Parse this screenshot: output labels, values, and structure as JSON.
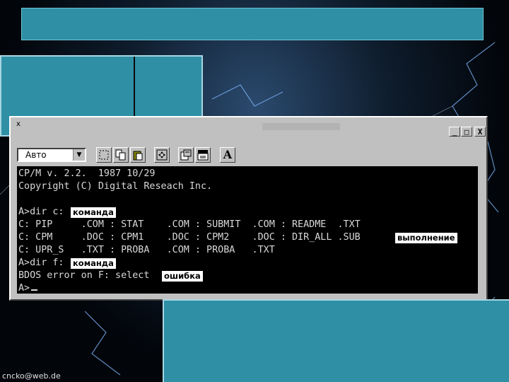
{
  "footer": {
    "email": "cncko@web.de"
  },
  "window": {
    "caption_glyph": "x",
    "buttons": {
      "minimize": "_",
      "maximize": "□",
      "close": "X"
    }
  },
  "toolbar": {
    "font_select": "Авто",
    "dropdown_arrow": "▼",
    "text_button": "A",
    "icons": [
      "select-icon",
      "copy-icon",
      "paste-icon",
      "fullscreen-icon",
      "properties-icon",
      "background-icon"
    ]
  },
  "terminal": {
    "lines": [
      "CP/M v. 2.2.  1987 10/29",
      "Copyright (C) Digital Reseach Inc.",
      "",
      "A>dir c:",
      "C: PIP     .COM : STAT    .COM : SUBMIT  .COM : README  .TXT",
      "C: CPM     .DOC : CPM1    .DOC : CPM2    .DOC : DIR_ALL .SUB",
      "C: UPR_S   .TXT : PROBA   .COM : PROBA   .TXT",
      "A>dir f:",
      "BDOS error on F: select",
      "A>"
    ],
    "tags": {
      "command1": "команда",
      "execution": "выполнение",
      "command2": "команда",
      "error": "ошибка"
    }
  },
  "colors": {
    "panel": "#2e8fa5",
    "terminal_bg": "#000000",
    "terminal_text": "#d9d9d9",
    "window_chrome": "#c0c0c0"
  }
}
